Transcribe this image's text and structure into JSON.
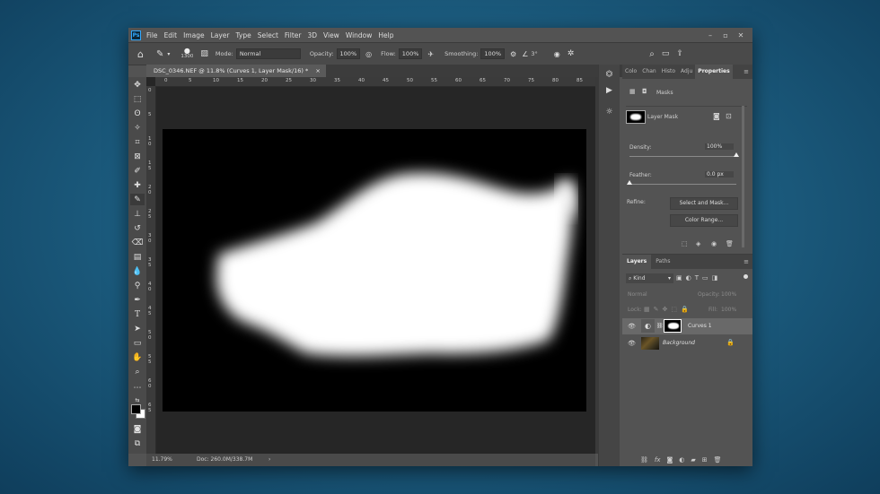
{
  "app": {
    "logo": "Ps"
  },
  "menu": [
    "File",
    "Edit",
    "Image",
    "Layer",
    "Type",
    "Select",
    "Filter",
    "3D",
    "View",
    "Window",
    "Help"
  ],
  "options": {
    "brush_size": "1300",
    "mode_label": "Mode:",
    "mode_value": "Normal",
    "opacity_label": "Opacity:",
    "opacity_value": "100%",
    "flow_label": "Flow:",
    "flow_value": "100%",
    "smoothing_label": "Smoothing:",
    "smoothing_value": "100%",
    "angle_value": "3°"
  },
  "document": {
    "tab_title": "DSC_0346.NEF @ 11.8% (Curves 1, Layer Mask/16) *",
    "close": "×",
    "ruler_h": [
      "0",
      "5",
      "10",
      "15",
      "20",
      "25",
      "30",
      "35",
      "40",
      "45",
      "50",
      "55",
      "60",
      "65",
      "70",
      "75",
      "80",
      "85"
    ],
    "ruler_v": [
      "0",
      "5",
      "1 0",
      "1 5",
      "2 0",
      "2 5",
      "3 0",
      "3 5",
      "4 0",
      "4 5",
      "5 0",
      "5 5",
      "6 0",
      "6 5"
    ]
  },
  "status": {
    "zoom": "11.79%",
    "doc": "Doc: 260.0M/338.7M",
    "arrow": "›"
  },
  "properties": {
    "tabs": [
      "Colo",
      "Chan",
      "Histo",
      "Adju",
      "Properties"
    ],
    "active_tab": "Properties",
    "section": "Masks",
    "mask_label": "Layer Mask",
    "density_label": "Density:",
    "density_value": "100%",
    "density_pct": 100,
    "feather_label": "Feather:",
    "feather_value": "0.0 px",
    "feather_pct": 0,
    "refine_label": "Refine:",
    "select_mask_btn": "Select and Mask...",
    "color_range_btn": "Color Range..."
  },
  "layers": {
    "tabs": [
      "Layers",
      "Paths"
    ],
    "filter_kind": "Kind",
    "blend_mode": "Normal",
    "opacity_label": "Opacity:",
    "opacity_value": "100%",
    "lock_label": "Lock:",
    "fill_label": "Fill:",
    "fill_value": "100%",
    "items": [
      {
        "name": "Curves 1",
        "selected": true
      },
      {
        "name": "Background",
        "selected": false
      }
    ]
  },
  "colors": {
    "accent": "#31a8ff",
    "panel": "#535353",
    "dark": "#262626"
  }
}
